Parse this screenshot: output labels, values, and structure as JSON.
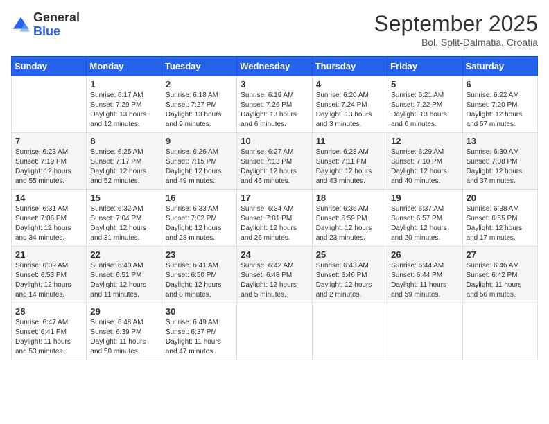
{
  "logo": {
    "general": "General",
    "blue": "Blue"
  },
  "header": {
    "month": "September 2025",
    "location": "Bol, Split-Dalmatia, Croatia"
  },
  "weekdays": [
    "Sunday",
    "Monday",
    "Tuesday",
    "Wednesday",
    "Thursday",
    "Friday",
    "Saturday"
  ],
  "weeks": [
    [
      {
        "day": "",
        "info": ""
      },
      {
        "day": "1",
        "info": "Sunrise: 6:17 AM\nSunset: 7:29 PM\nDaylight: 13 hours\nand 12 minutes."
      },
      {
        "day": "2",
        "info": "Sunrise: 6:18 AM\nSunset: 7:27 PM\nDaylight: 13 hours\nand 9 minutes."
      },
      {
        "day": "3",
        "info": "Sunrise: 6:19 AM\nSunset: 7:26 PM\nDaylight: 13 hours\nand 6 minutes."
      },
      {
        "day": "4",
        "info": "Sunrise: 6:20 AM\nSunset: 7:24 PM\nDaylight: 13 hours\nand 3 minutes."
      },
      {
        "day": "5",
        "info": "Sunrise: 6:21 AM\nSunset: 7:22 PM\nDaylight: 13 hours\nand 0 minutes."
      },
      {
        "day": "6",
        "info": "Sunrise: 6:22 AM\nSunset: 7:20 PM\nDaylight: 12 hours\nand 57 minutes."
      }
    ],
    [
      {
        "day": "7",
        "info": "Sunrise: 6:23 AM\nSunset: 7:19 PM\nDaylight: 12 hours\nand 55 minutes."
      },
      {
        "day": "8",
        "info": "Sunrise: 6:25 AM\nSunset: 7:17 PM\nDaylight: 12 hours\nand 52 minutes."
      },
      {
        "day": "9",
        "info": "Sunrise: 6:26 AM\nSunset: 7:15 PM\nDaylight: 12 hours\nand 49 minutes."
      },
      {
        "day": "10",
        "info": "Sunrise: 6:27 AM\nSunset: 7:13 PM\nDaylight: 12 hours\nand 46 minutes."
      },
      {
        "day": "11",
        "info": "Sunrise: 6:28 AM\nSunset: 7:11 PM\nDaylight: 12 hours\nand 43 minutes."
      },
      {
        "day": "12",
        "info": "Sunrise: 6:29 AM\nSunset: 7:10 PM\nDaylight: 12 hours\nand 40 minutes."
      },
      {
        "day": "13",
        "info": "Sunrise: 6:30 AM\nSunset: 7:08 PM\nDaylight: 12 hours\nand 37 minutes."
      }
    ],
    [
      {
        "day": "14",
        "info": "Sunrise: 6:31 AM\nSunset: 7:06 PM\nDaylight: 12 hours\nand 34 minutes."
      },
      {
        "day": "15",
        "info": "Sunrise: 6:32 AM\nSunset: 7:04 PM\nDaylight: 12 hours\nand 31 minutes."
      },
      {
        "day": "16",
        "info": "Sunrise: 6:33 AM\nSunset: 7:02 PM\nDaylight: 12 hours\nand 28 minutes."
      },
      {
        "day": "17",
        "info": "Sunrise: 6:34 AM\nSunset: 7:01 PM\nDaylight: 12 hours\nand 26 minutes."
      },
      {
        "day": "18",
        "info": "Sunrise: 6:36 AM\nSunset: 6:59 PM\nDaylight: 12 hours\nand 23 minutes."
      },
      {
        "day": "19",
        "info": "Sunrise: 6:37 AM\nSunset: 6:57 PM\nDaylight: 12 hours\nand 20 minutes."
      },
      {
        "day": "20",
        "info": "Sunrise: 6:38 AM\nSunset: 6:55 PM\nDaylight: 12 hours\nand 17 minutes."
      }
    ],
    [
      {
        "day": "21",
        "info": "Sunrise: 6:39 AM\nSunset: 6:53 PM\nDaylight: 12 hours\nand 14 minutes."
      },
      {
        "day": "22",
        "info": "Sunrise: 6:40 AM\nSunset: 6:51 PM\nDaylight: 12 hours\nand 11 minutes."
      },
      {
        "day": "23",
        "info": "Sunrise: 6:41 AM\nSunset: 6:50 PM\nDaylight: 12 hours\nand 8 minutes."
      },
      {
        "day": "24",
        "info": "Sunrise: 6:42 AM\nSunset: 6:48 PM\nDaylight: 12 hours\nand 5 minutes."
      },
      {
        "day": "25",
        "info": "Sunrise: 6:43 AM\nSunset: 6:46 PM\nDaylight: 12 hours\nand 2 minutes."
      },
      {
        "day": "26",
        "info": "Sunrise: 6:44 AM\nSunset: 6:44 PM\nDaylight: 11 hours\nand 59 minutes."
      },
      {
        "day": "27",
        "info": "Sunrise: 6:46 AM\nSunset: 6:42 PM\nDaylight: 11 hours\nand 56 minutes."
      }
    ],
    [
      {
        "day": "28",
        "info": "Sunrise: 6:47 AM\nSunset: 6:41 PM\nDaylight: 11 hours\nand 53 minutes."
      },
      {
        "day": "29",
        "info": "Sunrise: 6:48 AM\nSunset: 6:39 PM\nDaylight: 11 hours\nand 50 minutes."
      },
      {
        "day": "30",
        "info": "Sunrise: 6:49 AM\nSunset: 6:37 PM\nDaylight: 11 hours\nand 47 minutes."
      },
      {
        "day": "",
        "info": ""
      },
      {
        "day": "",
        "info": ""
      },
      {
        "day": "",
        "info": ""
      },
      {
        "day": "",
        "info": ""
      }
    ]
  ]
}
